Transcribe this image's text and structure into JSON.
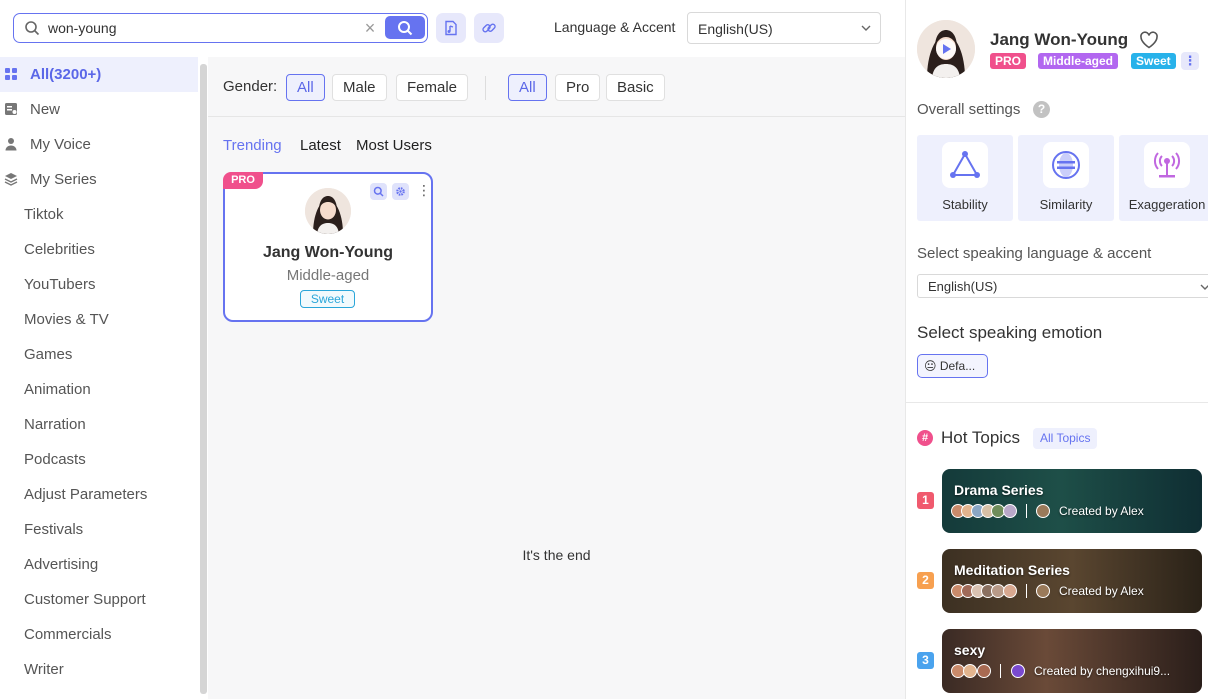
{
  "search": {
    "value": "won-young"
  },
  "header": {
    "language_label": "Language & Accent",
    "language_value": "English(US)"
  },
  "sidebar": {
    "items": [
      {
        "label": "All(3200+)",
        "icon": "grid-icon",
        "active": true
      },
      {
        "label": "New",
        "icon": "new-icon"
      },
      {
        "label": "My Voice",
        "icon": "user-icon"
      },
      {
        "label": "My Series",
        "icon": "layers-icon"
      },
      {
        "label": "Tiktok"
      },
      {
        "label": "Celebrities"
      },
      {
        "label": "YouTubers"
      },
      {
        "label": "Movies & TV"
      },
      {
        "label": "Games"
      },
      {
        "label": "Animation"
      },
      {
        "label": "Narration"
      },
      {
        "label": "Podcasts"
      },
      {
        "label": "Adjust Parameters"
      },
      {
        "label": "Festivals"
      },
      {
        "label": "Advertising"
      },
      {
        "label": "Customer Support"
      },
      {
        "label": "Commercials"
      },
      {
        "label": "Writer"
      }
    ]
  },
  "filters": {
    "gender_label": "Gender:",
    "gender": [
      "All",
      "Male",
      "Female"
    ],
    "tier": [
      "All",
      "Pro",
      "Basic"
    ]
  },
  "tabs": [
    "Trending",
    "Latest",
    "Most Users"
  ],
  "card": {
    "badge": "PRO",
    "name": "Jang Won-Young",
    "age": "Middle-aged",
    "tag": "Sweet"
  },
  "end_text": "It's the end",
  "panel": {
    "name": "Jang Won-Young",
    "badges": [
      "PRO",
      "Middle-aged",
      "Sweet"
    ],
    "overall_label": "Overall settings",
    "help": "?",
    "settings": [
      "Stability",
      "Similarity",
      "Exaggeration"
    ],
    "lang_label": "Select speaking language & accent",
    "lang_value": "English(US)",
    "emotion_label": "Select speaking emotion",
    "emotion_value": "😐 Defa...",
    "hot_icon": "#",
    "hot_label": "Hot Topics",
    "all_topics": "All Topics",
    "topics": [
      {
        "rank": "1",
        "title": "Drama Series",
        "by": "Created by Alex"
      },
      {
        "rank": "2",
        "title": "Meditation Series",
        "by": "Created by Alex"
      },
      {
        "rank": "3",
        "title": "sexy",
        "by": "Created by chengxihui9..."
      }
    ]
  },
  "colors": {
    "accent": "#6673f0",
    "pro": "#f0508c",
    "middle_aged": "#b267f0",
    "sweet": "#28b2ea",
    "rank1": "#f05a6e",
    "rank2": "#f7a050",
    "rank3": "#4aa3ee"
  }
}
